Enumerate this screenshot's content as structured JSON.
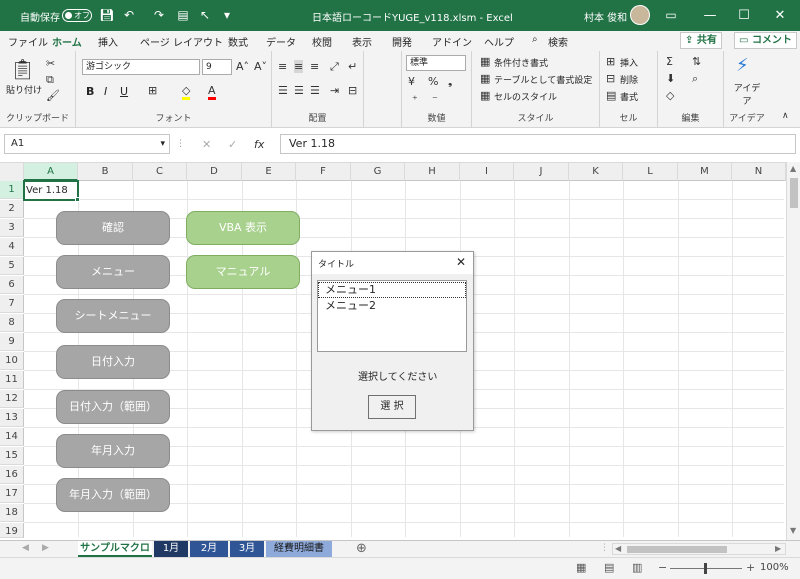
{
  "titlebar": {
    "autosave_label": "自動保存",
    "autosave_state": "オフ",
    "doc_title": "日本語ローコードYUGE_v118.xlsm  -  Excel",
    "user_name": "村本 俊和"
  },
  "tabs": [
    "ファイル",
    "ホーム",
    "挿入",
    "ページ レイアウト",
    "数式",
    "データ",
    "校閲",
    "表示",
    "開発",
    "アドイン",
    "ヘルプ",
    "検索"
  ],
  "share_label": "共有",
  "comment_label": "コメント",
  "ribbon": {
    "clipboard": {
      "paste": "貼り付け",
      "label": "クリップボード"
    },
    "font": {
      "name": "游ゴシック",
      "size": "9",
      "bold": "B",
      "italic": "I",
      "underline": "U",
      "label": "フォント"
    },
    "alignment": {
      "label": "配置"
    },
    "number": {
      "format": "標準",
      "label": "数値"
    },
    "styles": {
      "cond": "条件付き書式",
      "table": "テーブルとして書式設定",
      "cell": "セルのスタイル",
      "label": "スタイル"
    },
    "cells": {
      "insert": "挿入",
      "delete": "削除",
      "format": "書式",
      "label": "セル"
    },
    "editing": {
      "label": "編集"
    },
    "ideas": {
      "btn": "アイデア",
      "label": "アイデア"
    }
  },
  "formula_bar": {
    "namebox": "A1",
    "fx": "fx",
    "value": "Ver 1.18"
  },
  "columns": [
    "A",
    "B",
    "C",
    "D",
    "E",
    "F",
    "G",
    "H",
    "I",
    "J",
    "K",
    "L",
    "M",
    "N"
  ],
  "rows": [
    "1",
    "2",
    "3",
    "4",
    "5",
    "6",
    "7",
    "8",
    "9",
    "10",
    "11",
    "12",
    "13",
    "14",
    "15",
    "16",
    "17",
    "18",
    "19"
  ],
  "cell_a1": "Ver 1.18",
  "gray_buttons": [
    "確認",
    "メニュー",
    "シートメニュー",
    "日付入力",
    "日付入力（範囲）",
    "年月入力",
    "年月入力（範囲）"
  ],
  "green_buttons": [
    "VBA 表示",
    "マニュアル"
  ],
  "dialog": {
    "title": "タイトル",
    "items": [
      "メニュー1",
      "メニュー2"
    ],
    "prompt": "選択してください",
    "select_button": "選 択"
  },
  "sheet_tabs": [
    "サンプルマクロ",
    "1月",
    "2月",
    "3月",
    "経費明細書"
  ],
  "status": {
    "zoom": "100%"
  },
  "colors": {
    "excel_green": "#217346",
    "gray_button": "#a6a6a6",
    "green_button": "#a9d18e",
    "tab_blue_dark": "#1f3864",
    "tab_blue": "#2f5597",
    "tab_blue_light": "#8eaadb"
  }
}
